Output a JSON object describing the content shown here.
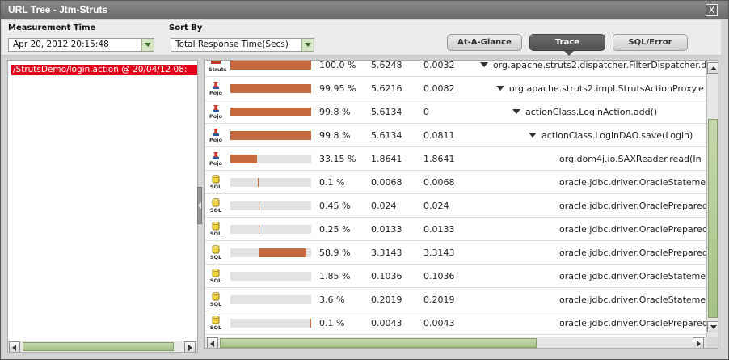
{
  "window": {
    "title": "URL Tree - Jtm-Struts",
    "close_label": "X"
  },
  "controls": {
    "measurement_label": "Measurement Time",
    "measurement_value": "Apr 20, 2012 20:15:48",
    "sortby_label": "Sort By",
    "sortby_value": "Total Response Time(Secs)",
    "tabs": [
      {
        "label": "At-A-Glance",
        "active": false
      },
      {
        "label": "Trace",
        "active": true
      },
      {
        "label": "SQL/Error",
        "active": false
      }
    ]
  },
  "left_pane": {
    "selected_item": "/StrutsDemo/login.action @ 20/04/12 08:"
  },
  "colors": {
    "selected_bg": "#e4001b",
    "bar_fill": "#c56a3f",
    "bar_track": "#e3e3e3",
    "scroll_thumb": "#b8cf9c"
  },
  "trace": {
    "rows": [
      {
        "icon": "struts-icon",
        "caption": "Struts",
        "pct": "100.0 %",
        "percent_value": 100,
        "rt": "5.6248",
        "st": "0.0032",
        "method": "org.apache.struts2.dispatcher.FilterDispatcher.d",
        "depth": 0,
        "expander": true
      },
      {
        "icon": "pojo-icon",
        "caption": "Pojo",
        "pct": "99.95 %",
        "percent_value": 99.95,
        "rt": "5.6216",
        "st": "0.0082",
        "method": "org.apache.struts2.impl.StrutsActionProxy.e",
        "depth": 1,
        "expander": true
      },
      {
        "icon": "pojo-icon",
        "caption": "Pojo",
        "pct": "99.8 %",
        "percent_value": 99.8,
        "rt": "5.6134",
        "st": "0",
        "method": "actionClass.LoginAction.add()",
        "depth": 2,
        "expander": true
      },
      {
        "icon": "pojo-icon",
        "caption": "Pojo",
        "pct": "99.8 %",
        "percent_value": 99.8,
        "rt": "5.6134",
        "st": "0.0811",
        "method": "actionClass.LoginDAO.save(Login)",
        "depth": 3,
        "expander": true
      },
      {
        "icon": "pojo-icon",
        "caption": "Pojo",
        "pct": "33.15 %",
        "percent_value": 33.15,
        "rt": "1.8641",
        "st": "1.8641",
        "method": "org.dom4j.io.SAXReader.read(In",
        "depth": 4,
        "expander": false
      },
      {
        "icon": "sql-icon",
        "caption": "SQL",
        "pct": "0.1 %",
        "percent_value": 0.1,
        "rt": "0.0068",
        "st": "0.0068",
        "method": "oracle.jdbc.driver.OracleStateme",
        "depth": 4,
        "expander": false
      },
      {
        "icon": "sql-icon",
        "caption": "SQL",
        "pct": "0.45 %",
        "percent_value": 0.45,
        "rt": "0.024",
        "st": "0.024",
        "method": "oracle.jdbc.driver.OraclePrepared",
        "depth": 4,
        "expander": false
      },
      {
        "icon": "sql-icon",
        "caption": "SQL",
        "pct": "0.25 %",
        "percent_value": 0.25,
        "rt": "0.0133",
        "st": "0.0133",
        "method": "oracle.jdbc.driver.OraclePrepared",
        "depth": 4,
        "expander": false
      },
      {
        "icon": "sql-icon",
        "caption": "SQL",
        "pct": "58.9 %",
        "percent_value": 58.9,
        "rt": "3.3143",
        "st": "3.3143",
        "method": "oracle.jdbc.driver.OraclePrepared",
        "depth": 4,
        "expander": false
      },
      {
        "icon": "sql-icon",
        "caption": "SQL",
        "pct": "1.85 %",
        "percent_value": 1.85,
        "rt": "0.1036",
        "st": "0.1036",
        "method": "oracle.jdbc.driver.OracleStateme",
        "depth": 4,
        "expander": false
      },
      {
        "icon": "sql-icon",
        "caption": "SQL",
        "pct": "3.6 %",
        "percent_value": 3.6,
        "rt": "0.2019",
        "st": "0.2019",
        "method": "oracle.jdbc.driver.OracleStateme",
        "depth": 4,
        "expander": false
      },
      {
        "icon": "sql-icon",
        "caption": "SQL",
        "pct": "0.1 %",
        "percent_value": 0.1,
        "rt": "0.0043",
        "st": "0.0043",
        "method": "oracle.jdbc.driver.OraclePrepared",
        "depth": 4,
        "expander": false
      }
    ]
  }
}
